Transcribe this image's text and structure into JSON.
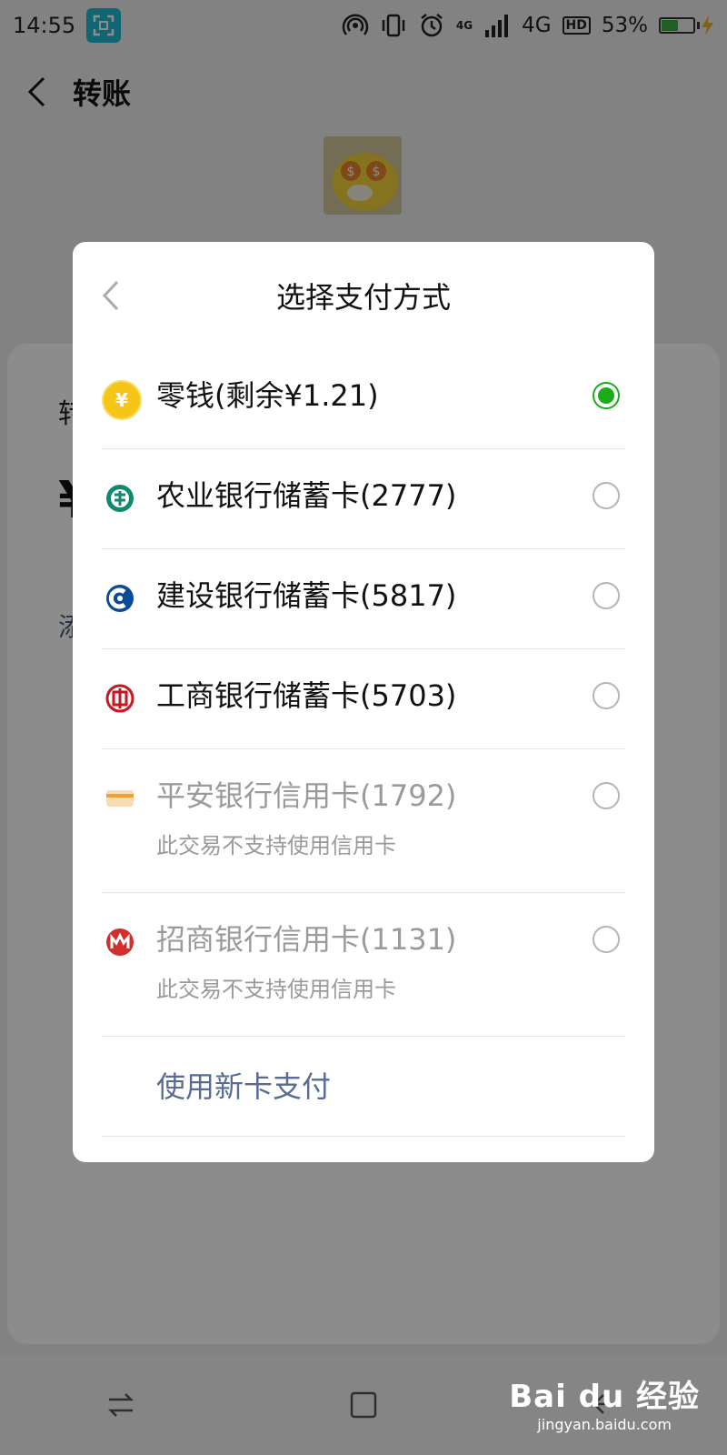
{
  "status_bar": {
    "time": "14:55",
    "network_tag": "4G",
    "network": "4G",
    "hd": "HD",
    "battery_percent_text": "53%",
    "battery_level": 0.53
  },
  "page": {
    "title": "转账",
    "transfer_label_partial": "转",
    "amount_symbol_partial": "¥",
    "note_partial": "添"
  },
  "dialog": {
    "title": "选择支付方式",
    "options": [
      {
        "label": "零钱(剩余¥1.21)",
        "icon": "coin-icon",
        "selected": true
      },
      {
        "label": "农业银行储蓄卡(2777)",
        "icon": "abc-bank-icon"
      },
      {
        "label": "建设银行储蓄卡(5817)",
        "icon": "ccb-bank-icon"
      },
      {
        "label": "工商银行储蓄卡(5703)",
        "icon": "icbc-bank-icon"
      },
      {
        "label": "平安银行信用卡(1792)",
        "sub": "此交易不支持使用信用卡",
        "icon": "pingan-bank-icon",
        "disabled": true
      },
      {
        "label": "招商银行信用卡(1131)",
        "sub": "此交易不支持使用信用卡",
        "icon": "cmb-bank-icon",
        "disabled": true
      }
    ],
    "new_card_label": "使用新卡支付"
  },
  "watermark": {
    "brand": "Bai du 经验",
    "url": "jingyan.baidu.com"
  },
  "colors": {
    "accent_green": "#1aad19",
    "link_blue": "#576b95",
    "scan_badge": "#1ebbd1"
  }
}
